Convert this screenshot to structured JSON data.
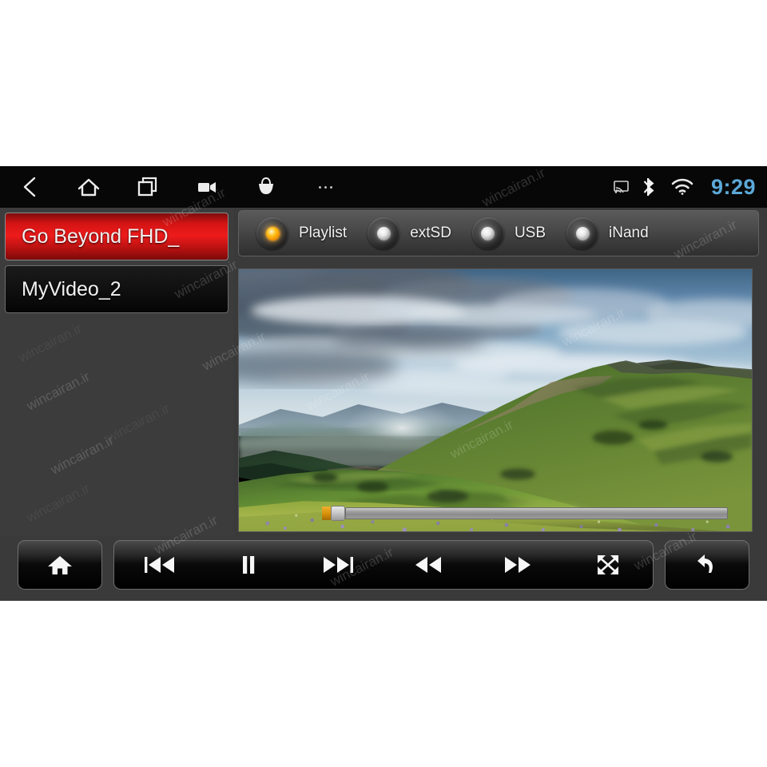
{
  "statusbar": {
    "nav": [
      {
        "name": "back-icon",
        "label": "Back"
      },
      {
        "name": "home-icon",
        "label": "Home"
      },
      {
        "name": "recents-icon",
        "label": "Recent apps"
      },
      {
        "name": "video-camera-icon",
        "label": "Camera"
      },
      {
        "name": "shopping-bag-icon",
        "label": "Apps"
      },
      {
        "name": "overflow-menu-icon",
        "label": "More"
      }
    ],
    "system_icons": [
      {
        "name": "screen-cast-icon",
        "label": "Cast"
      },
      {
        "name": "bluetooth-icon",
        "label": "Bluetooth"
      },
      {
        "name": "wifi-icon",
        "label": "Wi-Fi"
      }
    ],
    "clock": "9:29",
    "clock_color": "#5ba8d8"
  },
  "playlist": {
    "items": [
      {
        "label": "Go Beyond FHD_",
        "selected": true
      },
      {
        "label": "MyVideo_2",
        "selected": false
      }
    ],
    "selected_color": "#ee1b1b"
  },
  "sources": {
    "options": [
      {
        "label": "Playlist",
        "selected": true
      },
      {
        "label": "extSD",
        "selected": false
      },
      {
        "label": "USB",
        "selected": false
      },
      {
        "label": "iNand",
        "selected": false
      }
    ],
    "active_bulb_color": "#ffc21a"
  },
  "player": {
    "seek": {
      "progress_percent": 1,
      "thumb_color": "#d88f08",
      "track_color": "#a6a6a6"
    },
    "now_playing": "Go Beyond FHD_"
  },
  "controls": {
    "home": {
      "label": "Home",
      "icon": "home-icon"
    },
    "transport": [
      {
        "label": "Previous",
        "icon": "previous-track-icon"
      },
      {
        "label": "Pause",
        "icon": "pause-icon"
      },
      {
        "label": "Next",
        "icon": "next-track-icon"
      },
      {
        "label": "Rewind",
        "icon": "rewind-icon"
      },
      {
        "label": "Fast forward",
        "icon": "fast-forward-icon"
      },
      {
        "label": "Fullscreen",
        "icon": "fullscreen-icon"
      }
    ],
    "back": {
      "label": "Back",
      "icon": "return-arrow-icon"
    }
  },
  "watermark": {
    "text": "wincairan.ir"
  }
}
